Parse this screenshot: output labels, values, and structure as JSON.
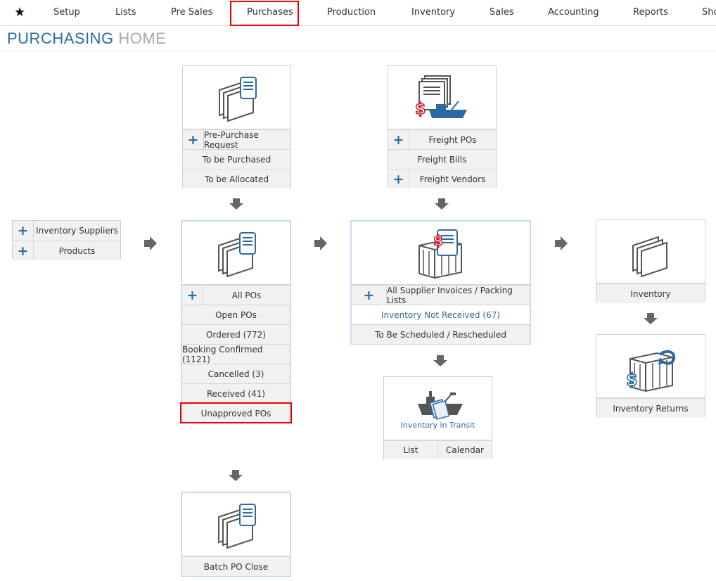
{
  "nav": {
    "items": [
      "Setup",
      "Lists",
      "Pre Sales",
      "Purchases",
      "Production",
      "Inventory",
      "Sales",
      "Accounting",
      "Reports",
      "Sho"
    ],
    "active": "Purchases"
  },
  "page_title": {
    "part1": "PURCHASING",
    "part2": "HOME"
  },
  "suppliers_card": {
    "rows": [
      "Inventory Suppliers",
      "Products"
    ]
  },
  "prepurchase_card": {
    "rows": [
      "Pre-Purchase Request",
      "To be Purchased",
      "To be Allocated"
    ]
  },
  "freight_card": {
    "rows": [
      "Freight POs",
      "Freight Bills",
      "Freight Vendors"
    ]
  },
  "pos_card": {
    "rows": [
      "All POs",
      "Open POs",
      "Ordered (772)",
      "Booking Confirmed (1121)",
      "Cancelled (3)",
      "Received (41)",
      "Unapproved POs"
    ]
  },
  "invoices_card": {
    "rows": [
      "All Supplier Invoices / Packing Lists",
      "Inventory Not Received (67)",
      "To Be Scheduled / Rescheduled"
    ]
  },
  "transit_card": {
    "label": "Inventory in Transit",
    "buttons": [
      "List",
      "Calendar"
    ]
  },
  "inventory_card": {
    "label": "Inventory"
  },
  "returns_card": {
    "label": "Inventory Returns"
  },
  "batch_card": {
    "label": "Batch PO Close"
  },
  "colors": {
    "accent": "#2d6aa3",
    "highlight": "#e00000",
    "dollar": "#c8202f"
  }
}
